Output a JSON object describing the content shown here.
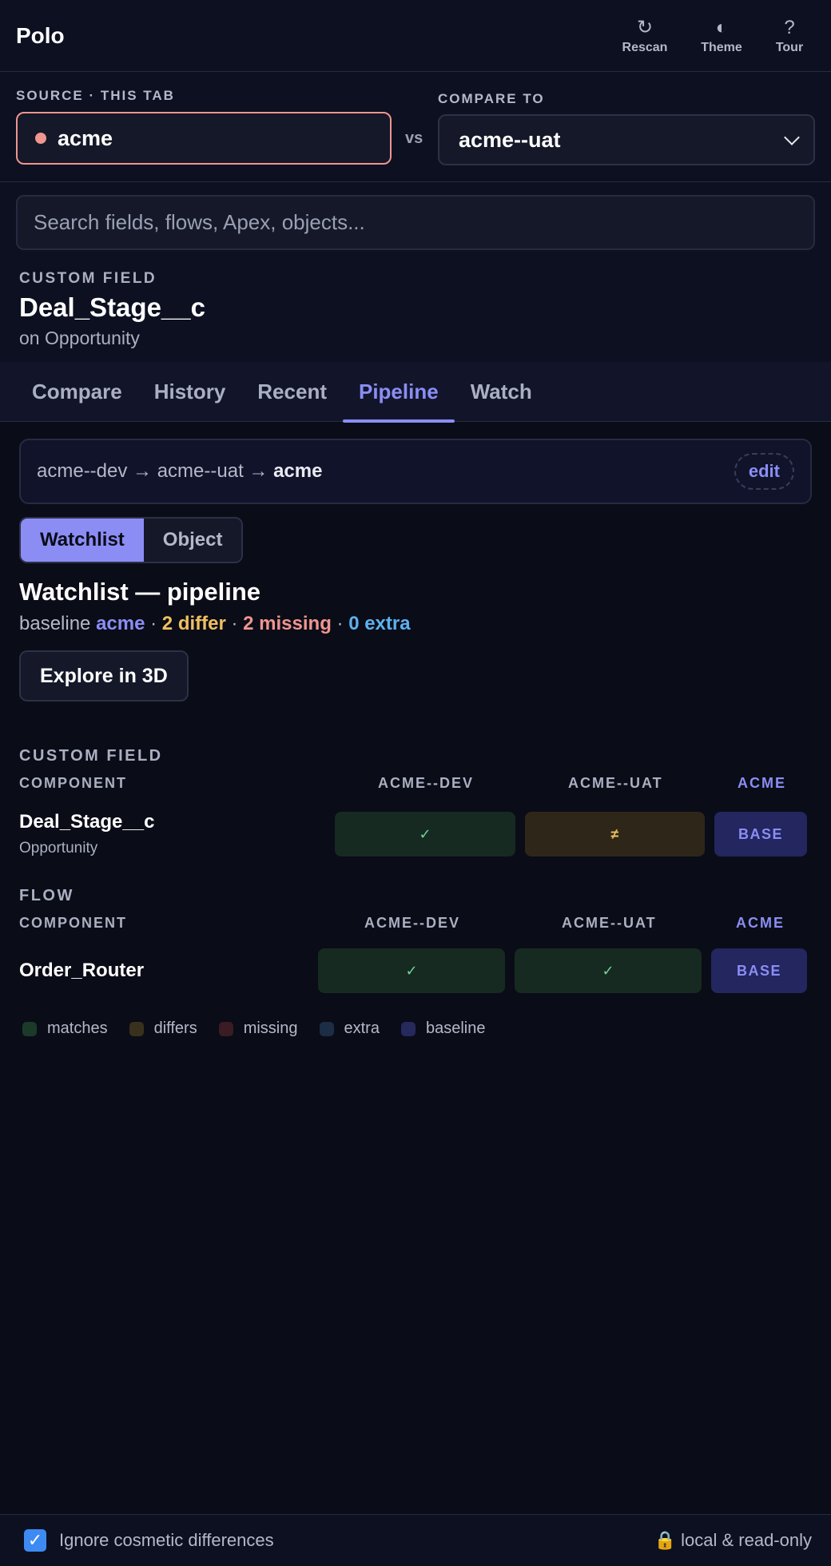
{
  "app": {
    "name": "Polo"
  },
  "header": {
    "rescan_label": "Rescan",
    "theme_label": "Theme",
    "tour_label": "Tour",
    "rescan_icon": "↻",
    "theme_icon": "◐",
    "tour_icon": "?"
  },
  "env": {
    "source_label": "SOURCE · THIS TAB",
    "source_value": "acme",
    "vs": "vs",
    "compare_label": "COMPARE TO",
    "compare_value": "acme--uat"
  },
  "search": {
    "placeholder": "Search fields, flows, Apex, objects..."
  },
  "component": {
    "kind": "CUSTOM FIELD",
    "name": "Deal_Stage__c",
    "object": "on Opportunity"
  },
  "tabs": [
    "Compare",
    "History",
    "Recent",
    "Pipeline",
    "Watch"
  ],
  "active_tab": "Pipeline",
  "pipeline": {
    "path": "acme--dev → acme--uat → ",
    "last": "acme",
    "edit_label": "edit"
  },
  "segment": {
    "watchlist": "Watchlist",
    "object": "Object",
    "selected": "Watchlist"
  },
  "watchlist": {
    "title": "Watchlist — pipeline",
    "baseline_prefix": "baseline ",
    "baseline": "acme",
    "sep": " · ",
    "differ": "2 differ",
    "missing": "2 missing",
    "extra": "0 extra",
    "explore_label": "Explore in 3D"
  },
  "sections": [
    {
      "title": "CUSTOM FIELD",
      "component_header": "COMPONENT",
      "columns": [
        "ACME--DEV",
        "ACME--UAT",
        "ACME"
      ],
      "rows": [
        {
          "name": "Deal_Stage__c",
          "object": "Opportunity",
          "cells": [
            "✓",
            "≠",
            "BASE"
          ]
        }
      ]
    },
    {
      "title": "FLOW",
      "component_header": "COMPONENT",
      "columns": [
        "ACME--DEV",
        "ACME--UAT",
        "ACME"
      ],
      "rows": [
        {
          "name": "Order_Router",
          "cells": [
            "✓",
            "✓",
            "BASE"
          ]
        }
      ]
    }
  ],
  "legend": [
    {
      "label": "matches",
      "color": "#1c3a2a"
    },
    {
      "label": "differs",
      "color": "#3a311c"
    },
    {
      "label": "missing",
      "color": "#3a1c22"
    },
    {
      "label": "extra",
      "color": "#1c2d45"
    },
    {
      "label": "baseline",
      "color": "#26295c"
    }
  ],
  "footer": {
    "ignore_label": "Ignore cosmetic differences",
    "ignore_checked": true,
    "check_icon": "✓",
    "status": "🔒 local & read-only"
  }
}
